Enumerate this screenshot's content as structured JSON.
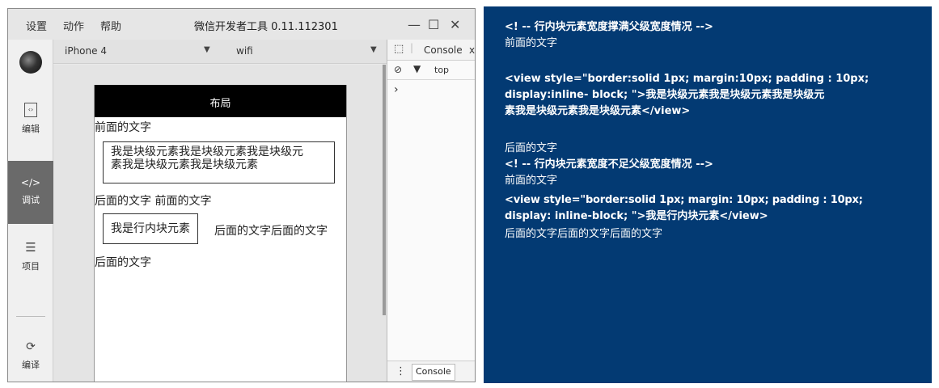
{
  "ide": {
    "menu": [
      "设置",
      "动作",
      "帮助"
    ],
    "title": "微信开发者工具 0.11.112301",
    "window_controls": {
      "minimize": "—",
      "maximize": "☐",
      "close": "✕"
    },
    "sidebar": {
      "items": [
        {
          "label": "编辑",
          "icon": "code-file-icon",
          "glyph": "‹›"
        },
        {
          "label": "调试",
          "icon": "code-brackets-icon",
          "glyph": "</>"
        },
        {
          "label": "项目",
          "icon": "menu-lines-icon",
          "glyph": "☰"
        },
        {
          "label": "编译",
          "icon": "compile-icon",
          "glyph": "⟳"
        }
      ],
      "active": "调试"
    },
    "simulator": {
      "device": "iPhone 4",
      "network": "wifi",
      "dropdown_glyph": "▼"
    },
    "phone": {
      "nav_title": "布局",
      "lines": {
        "before1": "前面的文字",
        "block_box_line1": "我是块级元素我是块级元素我是块级元",
        "block_box_line2": "素我是块级元素我是块级元素",
        "after_before": "后面的文字 前面的文字",
        "inline_box": "我是行内块元素",
        "after_inline": "后面的文字后面的文字",
        "after2": "后面的文字"
      }
    },
    "devtools": {
      "tab": "Console",
      "tab_close": "x",
      "filter": "top",
      "prompt": "›",
      "bottom_tab": "Console",
      "bottom_menu": "⋮"
    }
  },
  "code_panel": {
    "background": "#033a73",
    "lines": [
      "<! -- 行内块元素宽度撑满父级宽度情况 -->",
      "前面的文字",
      "<view style=\"border:solid 1px; margin:10px; padding : 10px;",
      "display:inline-   block; \">我是块级元素我是块级元素我是块级元",
      "素我是块级元素我是块级元素</view>",
      "后面的文字",
      "<! -- 行内块元素宽度不足父级宽度情况 -->",
      "前面的文字",
      "<view  style=\"border:solid  1px;  margin:  10px;  padding  :  10px;",
      "display:   inline-block; \">我是行内块元素</view>",
      "后面的文字后面的文字后面的文字"
    ]
  }
}
